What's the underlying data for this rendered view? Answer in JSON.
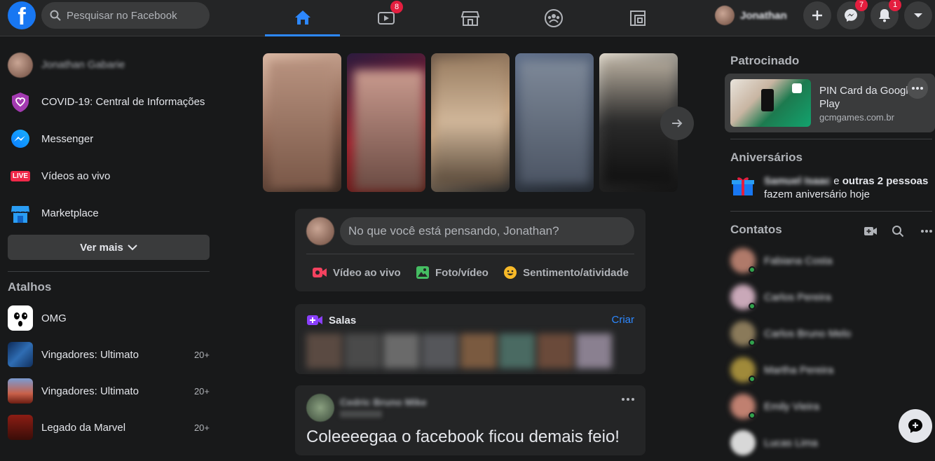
{
  "topbar": {
    "logo": "f",
    "search_placeholder": "Pesquisar no Facebook",
    "tabs": [
      {
        "name": "home",
        "badge": ""
      },
      {
        "name": "watch",
        "badge": "8"
      },
      {
        "name": "marketplace",
        "badge": ""
      },
      {
        "name": "groups",
        "badge": ""
      },
      {
        "name": "gaming",
        "badge": ""
      }
    ],
    "profile_name": "Jonathan",
    "messenger_badge": "7",
    "notifications_badge": "1"
  },
  "left": {
    "profile_name": "Jonathan Gabarie",
    "items": [
      {
        "label": "COVID-19: Central de Informações",
        "icon": "covid-info-icon"
      },
      {
        "label": "Messenger",
        "icon": "messenger-icon"
      },
      {
        "label": "Vídeos ao vivo",
        "icon": "live-icon",
        "icon_text": "LIVE"
      },
      {
        "label": "Marketplace",
        "icon": "marketplace-icon"
      }
    ],
    "see_more": "Ver mais",
    "shortcuts_title": "Atalhos",
    "shortcuts": [
      {
        "label": "OMG",
        "count": ""
      },
      {
        "label": "Vingadores: Ultimato",
        "count": "20+"
      },
      {
        "label": "Vingadores: Ultimato",
        "count": "20+"
      },
      {
        "label": "Legado da Marvel",
        "count": "20+"
      }
    ]
  },
  "composer": {
    "placeholder": "No que você está pensando, Jonathan?",
    "actions": [
      {
        "label": "Vídeo ao vivo",
        "icon": "live-video-icon",
        "color": "#f3425f"
      },
      {
        "label": "Foto/vídeo",
        "icon": "photo-icon",
        "color": "#45bd62"
      },
      {
        "label": "Sentimento/atividade",
        "icon": "feeling-icon",
        "color": "#f7b928"
      }
    ]
  },
  "rooms": {
    "title": "Salas",
    "create": "Criar"
  },
  "post": {
    "author": "Cedric Bruno Mike",
    "text": "Coleeeegaa o facebook ficou demais feio!"
  },
  "right": {
    "sponsored_title": "Patrocinado",
    "ad": {
      "title": "PIN Card da Google Play",
      "domain": "gcmgames.com.br"
    },
    "birthdays_title": "Aniversários",
    "birthday": {
      "name": "Samuel Isaac",
      "connector": " e ",
      "others": "outras 2 pessoas",
      "suffix": "fazem aniversário hoje"
    },
    "contacts_title": "Contatos",
    "contacts": [
      "Fabiana Costa",
      "Carlos Pereira",
      "Carlos Bruno Melo",
      "Martha Pereira",
      "Emily Vieira",
      "Lucas Lima"
    ]
  },
  "colors": {
    "accent": "#2d88ff",
    "badge": "#e41e3f",
    "online": "#31a24c"
  }
}
